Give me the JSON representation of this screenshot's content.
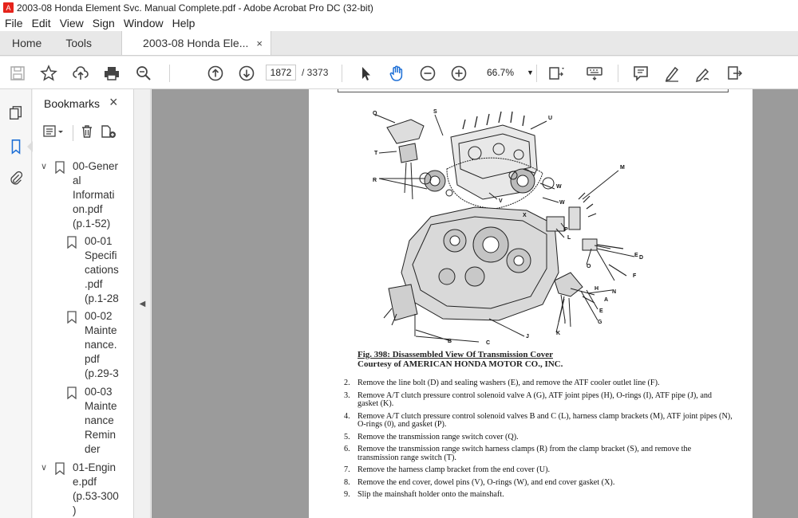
{
  "window": {
    "title": "2003-08 Honda Element Svc. Manual Complete.pdf - Adobe Acrobat Pro DC (32-bit)"
  },
  "menu": [
    "File",
    "Edit",
    "View",
    "Sign",
    "Window",
    "Help"
  ],
  "tabs": {
    "home": "Home",
    "tools": "Tools",
    "document": "2003-08 Honda Ele...",
    "close": "×"
  },
  "toolbar": {
    "page_current": "1872",
    "page_total": "/ 3373",
    "zoom": "66.7%"
  },
  "sidebar": {
    "title": "Bookmarks",
    "close": "×",
    "items": [
      {
        "lines": "00-Gener\nal\nInformati\non.pdf\n(p.1-52)",
        "expanded": true
      },
      {
        "lines": "00-01\nSpecifi\ncations\n.pdf\n(p.1-28"
      },
      {
        "lines": "00-02\nMainte\nnance.\npdf\n(p.29-3"
      },
      {
        "lines": "00-03\nMainte\nnance\nRemin\nder"
      },
      {
        "lines": "01-Engin\ne.pdf\n(p.53-300\n)",
        "expanded": true
      }
    ]
  },
  "document": {
    "caption_title": "Fig. 398: Disassembled View Of Transmission Cover",
    "caption_credit": "Courtesy of AMERICAN HONDA MOTOR CO., INC.",
    "steps": [
      {
        "n": "2.",
        "text": "Remove the line bolt (D) and sealing washers (E), and remove the ATF cooler outlet line (F)."
      },
      {
        "n": "3.",
        "text": "Remove A/T clutch pressure control solenoid valve A (G), ATF joint pipes (H), O-rings (I), ATF pipe (J), and gasket (K)."
      },
      {
        "n": "4.",
        "text": "Remove A/T clutch pressure control solenoid valves B and C (L), harness clamp brackets (M), ATF joint pipes (N), O-rings (0), and gasket (P)."
      },
      {
        "n": "5.",
        "text": "Remove the transmission range switch cover (Q)."
      },
      {
        "n": "6.",
        "text": "Remove the transmission range switch harness clamps (R) from the clamp bracket (S), and remove the transmission range switch (T)."
      },
      {
        "n": "7.",
        "text": "Remove the harness clamp bracket from the end cover (U)."
      },
      {
        "n": "8.",
        "text": "Remove the end cover, dowel pins (V), O-rings (W), and end cover gasket (X)."
      },
      {
        "n": "9.",
        "text": "Slip the mainshaft holder onto the mainshaft."
      }
    ],
    "diagram_labels": [
      "Q",
      "S",
      "U",
      "T",
      "R",
      "W",
      "V",
      "W",
      "X",
      "M",
      "P",
      "L",
      "O",
      "E",
      "D",
      "F",
      "N",
      "H",
      "E",
      "G",
      "I",
      "K",
      "J",
      "C",
      "B",
      "A"
    ]
  }
}
